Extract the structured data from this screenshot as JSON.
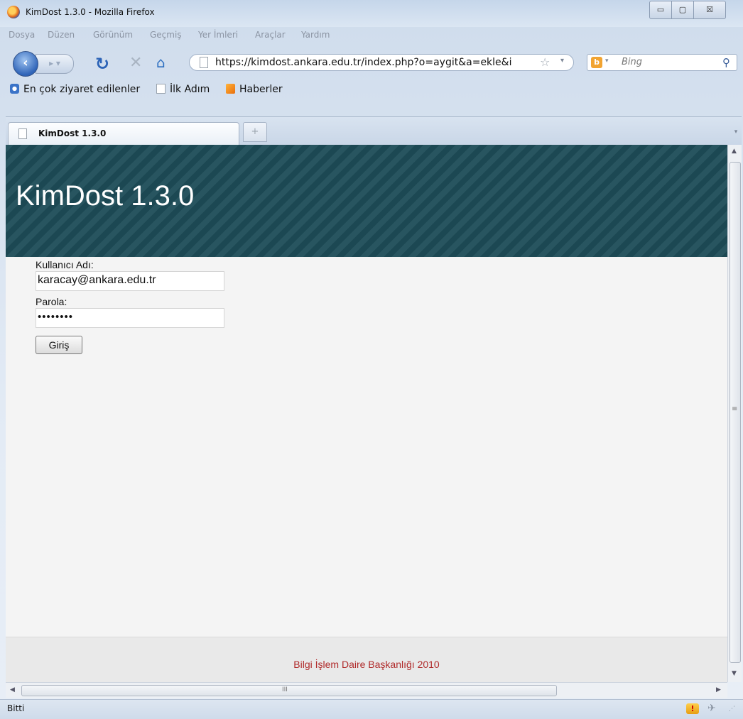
{
  "window": {
    "title": "KimDost 1.3.0 - Mozilla Firefox",
    "controls": {
      "minimize": "▭",
      "maximize": "▢",
      "close": "☒"
    }
  },
  "menu": [
    "Dosya",
    "Düzen",
    "Görünüm",
    "Geçmiş",
    "Yer İmleri",
    "Araçlar",
    "Yardım"
  ],
  "navbar": {
    "url": "https://kimdost.ankara.edu.tr/index.php?o=aygit&a=ekle&i",
    "search_placeholder": "Bing",
    "icons": [
      "back-icon",
      "forward-icon",
      "reload-icon",
      "stop-icon",
      "home-icon",
      "bookmark-star-icon",
      "search-icon"
    ]
  },
  "bookmarks": [
    "En çok ziyaret edilenler",
    "İlk Adım",
    "Haberler"
  ],
  "tabs": [
    {
      "label": "KimDost 1.3.0",
      "active": true
    }
  ],
  "page": {
    "site_title": "KimDost 1.3.0",
    "username_label": "Kullanıcı Adı:",
    "username_value": "karacay@ankara.edu.tr",
    "password_label": "Parola:",
    "password_mask": "••••••••",
    "login_button": "Giriş",
    "footer": "Bilgi İşlem Daire Başkanlığı 2010"
  },
  "scrollbar": {
    "h_grip": "III",
    "v_grip": "≡"
  },
  "status": {
    "text": "Bitti"
  },
  "colors": {
    "header_bg": "#1d4c57",
    "footer_text": "#b02a2a",
    "page_bg": "#f4f4f4"
  }
}
